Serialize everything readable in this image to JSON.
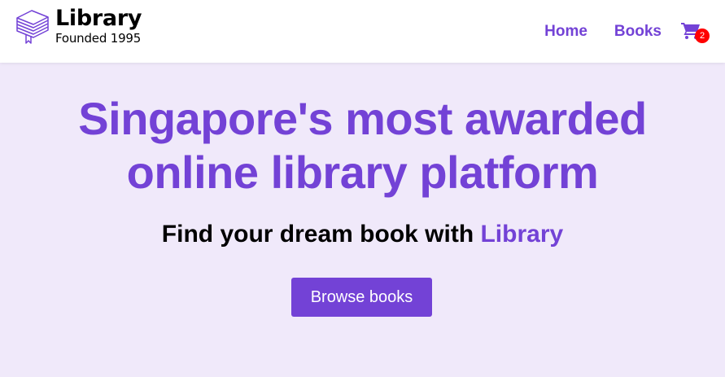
{
  "brand": {
    "title": "Library",
    "subtitle": "Founded 1995",
    "logo_icon": "book-stack-icon"
  },
  "nav": {
    "links": [
      {
        "label": "Home"
      },
      {
        "label": "Books"
      }
    ],
    "cart": {
      "icon": "shopping-cart-icon",
      "count": "2"
    }
  },
  "hero": {
    "title_line1": "Singapore's most awarded",
    "title_line2": "online library platform",
    "subtitle_prefix": "Find your dream book with ",
    "subtitle_accent": "Library",
    "button_label": "Browse books"
  },
  "colors": {
    "accent": "#7342d6",
    "hero_bg": "#f0e9fa",
    "badge": "#ff0000"
  }
}
